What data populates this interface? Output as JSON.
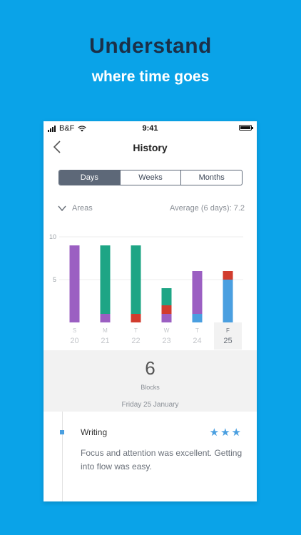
{
  "promo": {
    "headline": "Understand",
    "subheadline": "where time goes"
  },
  "status_bar": {
    "carrier": "B&F",
    "time": "9:41"
  },
  "nav": {
    "title": "History"
  },
  "tabs": [
    {
      "label": "Days",
      "active": true
    },
    {
      "label": "Weeks",
      "active": false
    },
    {
      "label": "Months",
      "active": false
    }
  ],
  "areas_toggle": {
    "label": "Areas"
  },
  "average": {
    "text": "Average (6 days): 7.2"
  },
  "chart_data": {
    "type": "bar",
    "stacked": true,
    "y_ticks": [
      5,
      10
    ],
    "ylim": [
      0,
      10
    ],
    "days": [
      {
        "letter": "S",
        "number": "20",
        "selected": false
      },
      {
        "letter": "M",
        "number": "21",
        "selected": false
      },
      {
        "letter": "T",
        "number": "22",
        "selected": false
      },
      {
        "letter": "W",
        "number": "23",
        "selected": false
      },
      {
        "letter": "T",
        "number": "24",
        "selected": false
      },
      {
        "letter": "F",
        "number": "25",
        "selected": true
      }
    ],
    "series_colors": [
      "#9b5fc2",
      "#1ea585",
      "#d13c2e",
      "#4a9fe0"
    ],
    "stacks": [
      [
        {
          "color": "#9b5fc2",
          "value": 9
        }
      ],
      [
        {
          "color": "#9b5fc2",
          "value": 1
        },
        {
          "color": "#1ea585",
          "value": 8
        }
      ],
      [
        {
          "color": "#d13c2e",
          "value": 1
        },
        {
          "color": "#1ea585",
          "value": 8
        }
      ],
      [
        {
          "color": "#9b5fc2",
          "value": 1
        },
        {
          "color": "#d13c2e",
          "value": 1
        },
        {
          "color": "#1ea585",
          "value": 2
        }
      ],
      [
        {
          "color": "#4a9fe0",
          "value": 1
        },
        {
          "color": "#9b5fc2",
          "value": 5
        }
      ],
      [
        {
          "color": "#4a9fe0",
          "value": 5
        },
        {
          "color": "#d13c2e",
          "value": 1
        }
      ]
    ]
  },
  "summary": {
    "count": "6",
    "unit": "Blocks",
    "date": "Friday 25 January"
  },
  "entry": {
    "title": "Writing",
    "rating": "★★★",
    "rating_value": 3,
    "note": "Focus and attention was excellent. Getting into flow was easy."
  }
}
